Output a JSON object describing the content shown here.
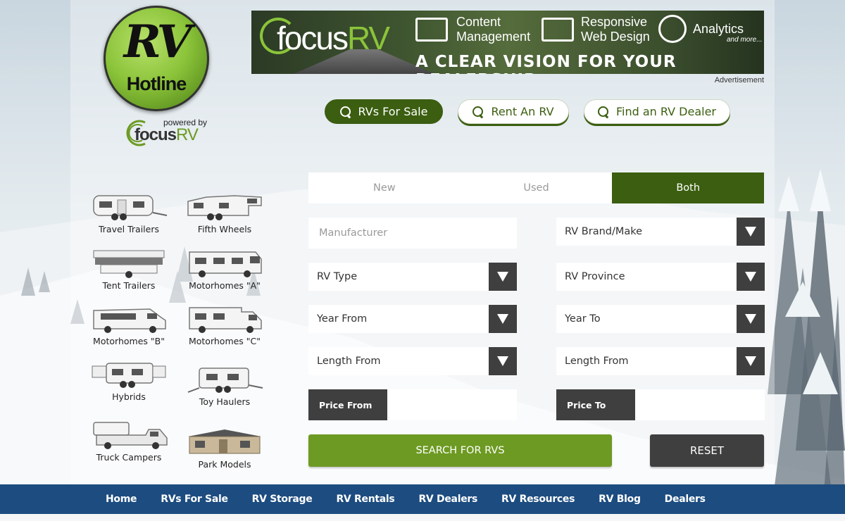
{
  "logo": {
    "line1": "RV",
    "line2": "Hotline",
    "powered_by": "powered by",
    "brand_a": "focus",
    "brand_b": "RV"
  },
  "banner": {
    "brand_a": "focus",
    "brand_b": "RV",
    "feature1": "Content\nManagement",
    "feature2": "Responsive\nWeb Design",
    "feature3": "Analytics",
    "more": "and more...",
    "tagline": "A CLEAR VISION FOR YOUR DEALERSHIP",
    "ad_label": "Advertisement"
  },
  "top_buttons": [
    {
      "label": "RVs For Sale"
    },
    {
      "label": "Rent An RV"
    },
    {
      "label": "Find an RV Dealer"
    }
  ],
  "rv_types": [
    {
      "label": "Travel Trailers"
    },
    {
      "label": "Fifth Wheels"
    },
    {
      "label": "Tent Trailers"
    },
    {
      "label": "Motorhomes \"A\""
    },
    {
      "label": "Motorhomes \"B\""
    },
    {
      "label": "Motorhomes \"C\""
    },
    {
      "label": "Hybrids"
    },
    {
      "label": "Toy Haulers"
    },
    {
      "label": "Truck Campers"
    },
    {
      "label": "Park Models"
    }
  ],
  "condition_tabs": [
    {
      "label": "New"
    },
    {
      "label": "Used"
    },
    {
      "label": "Both"
    }
  ],
  "form": {
    "manufacturer_placeholder": "Manufacturer",
    "brand": "RV Brand/Make",
    "rv_type": "RV Type",
    "province": "RV Province",
    "year_from": "Year From",
    "year_to": "Year To",
    "length_from": "Length From",
    "length_to": "Length From",
    "price_from": "Price From",
    "price_to": "Price To",
    "search_label": "SEARCH FOR RVS",
    "reset_label": "RESET"
  },
  "nav": [
    {
      "label": "Home"
    },
    {
      "label": "RVs For Sale"
    },
    {
      "label": "RV Storage"
    },
    {
      "label": "RV Rentals"
    },
    {
      "label": "RV Dealers"
    },
    {
      "label": "RV Resources"
    },
    {
      "label": "RV Blog"
    },
    {
      "label": "Dealers"
    }
  ],
  "colors": {
    "brand_green": "#3b5e10",
    "button_green": "#6d9a22",
    "nav_blue": "#1c4c80",
    "dark": "#3f3f3f"
  }
}
